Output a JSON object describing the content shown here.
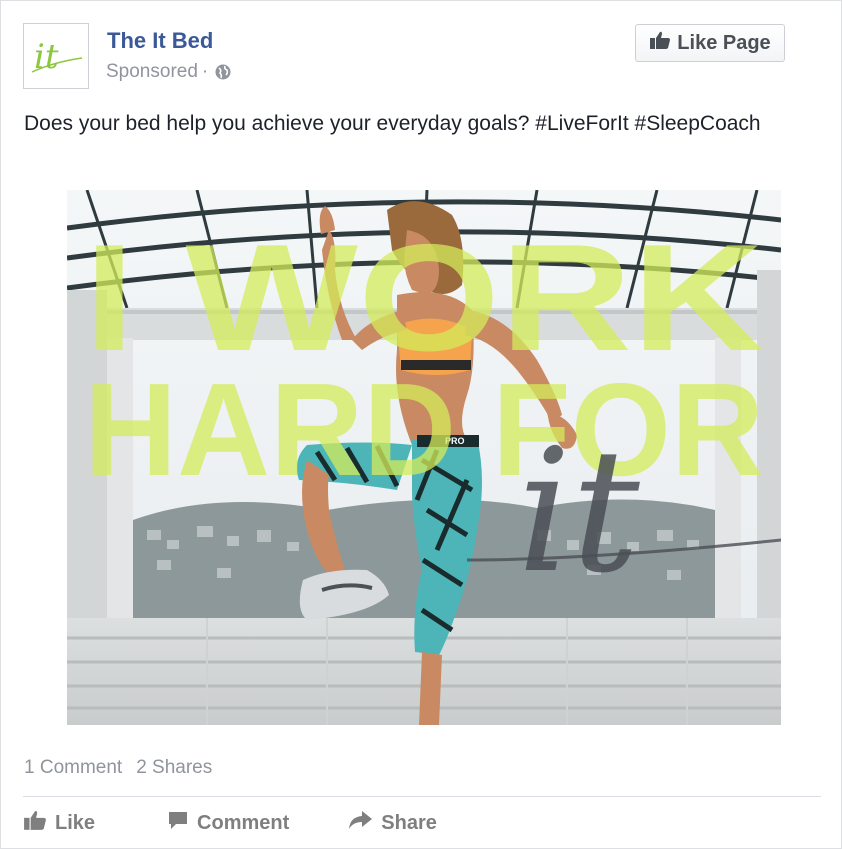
{
  "post": {
    "page_name": "The It Bed",
    "logo_text": "it",
    "sponsored": "Sponsored",
    "separator": "·",
    "like_page_label": "Like Page",
    "text": "Does your bed help you achieve your everyday goals? #LiveForIt #SleepCoach"
  },
  "image": {
    "line1": "I WORK",
    "line2": "HARD FOR",
    "script_word": "it",
    "shirt_text": "PRO",
    "accent_color": "#d4ec5a",
    "brand_green": "#8dc63f"
  },
  "stats": {
    "comments": "1 Comment",
    "shares": "2 Shares"
  },
  "actions": {
    "like": "Like",
    "comment": "Comment",
    "share": "Share"
  },
  "icons": {
    "thumb": "thumbs-up-icon",
    "globe": "globe-icon",
    "comment": "comment-bubble-icon",
    "share": "share-arrow-icon"
  }
}
